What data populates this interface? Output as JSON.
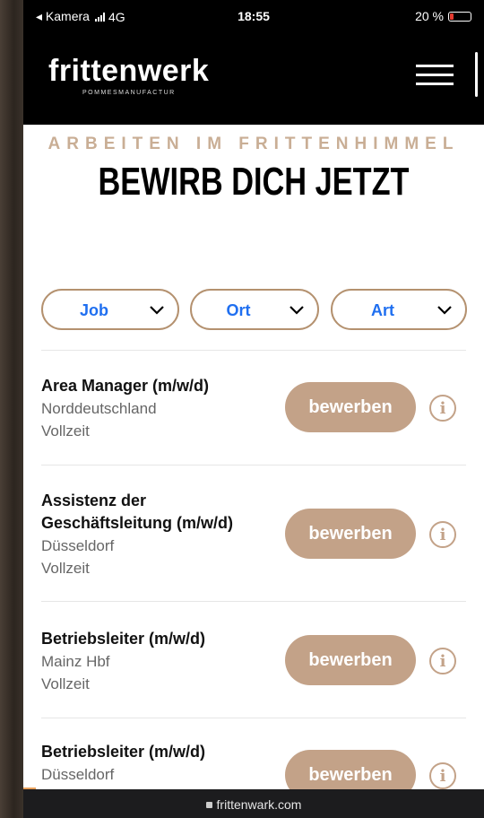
{
  "status_bar": {
    "back_label": "◂ Kamera",
    "network": "4G",
    "time": "18:55",
    "battery": "20 %"
  },
  "brand": {
    "logo": "frittenwerk",
    "tagline": "POMMESMANUFACTUR"
  },
  "hero": {
    "kicker": "ARBEITEN IM FRITTENHIMMEL",
    "title": "BEWIRB DICH JETZT"
  },
  "filters": [
    {
      "label": "Job"
    },
    {
      "label": "Ort"
    },
    {
      "label": "Art"
    }
  ],
  "jobs": [
    {
      "title_lines": [
        "Area Manager (m/w/d)"
      ],
      "location": "Norddeutschland",
      "type": "Vollzeit",
      "apply_label": "bewerben",
      "info_label": "i"
    },
    {
      "title_lines": [
        "Assistenz der",
        "Geschäftsleitung (m/w/d)"
      ],
      "location": "Düsseldorf",
      "type": "Vollzeit",
      "apply_label": "bewerben",
      "info_label": "i"
    },
    {
      "title_lines": [
        "Betriebsleiter (m/w/d)"
      ],
      "location": "Mainz Hbf",
      "type": "Vollzeit",
      "apply_label": "bewerben",
      "info_label": "i"
    },
    {
      "title_lines": [
        "Betriebsleiter (m/w/d)"
      ],
      "location": "Düsseldorf",
      "type": "",
      "apply_label": "bewerben",
      "info_label": "i"
    }
  ],
  "browser": {
    "url": "frittenwark.com"
  },
  "colors": {
    "accent": "#c3a288",
    "filter_border": "#b4916f",
    "filter_text": "#1f6ff0",
    "header_bg": "#000000"
  }
}
